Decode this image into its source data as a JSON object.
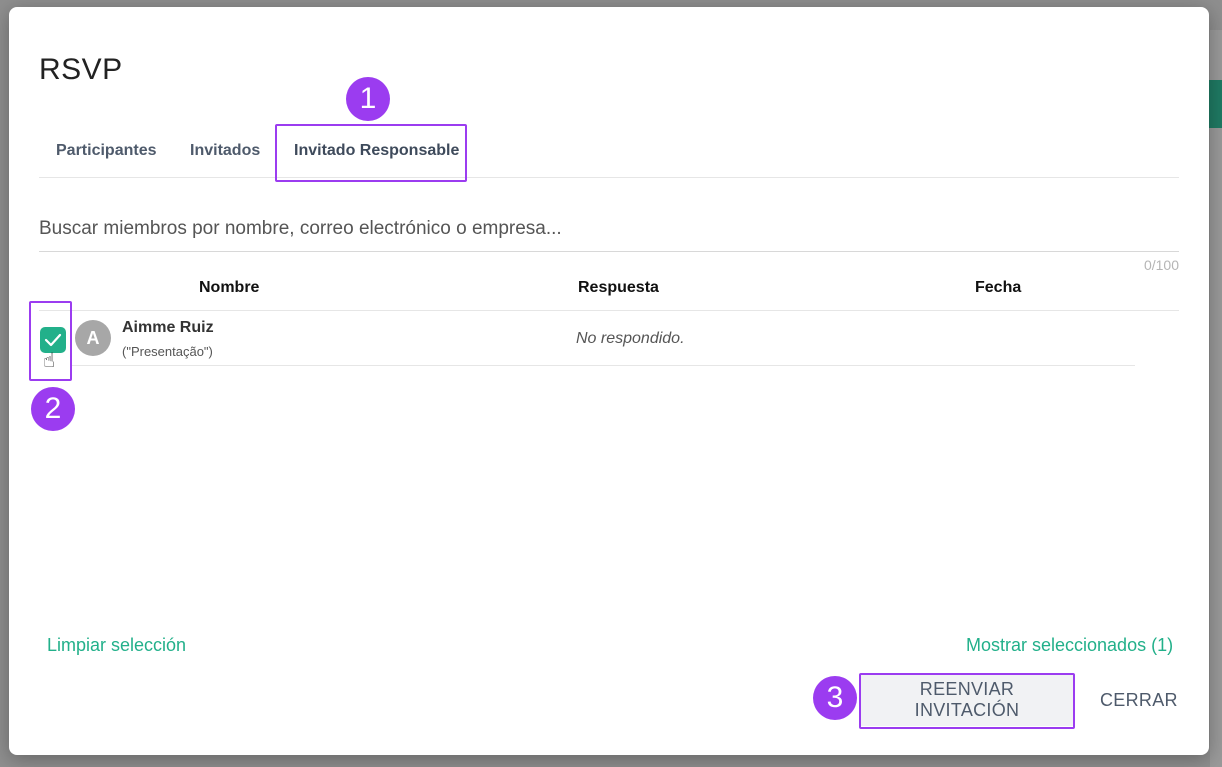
{
  "modal": {
    "title": "RSVP",
    "tabs": [
      {
        "label": "Participantes"
      },
      {
        "label": "Invitados"
      },
      {
        "label": "Invitado Responsable"
      }
    ],
    "active_tab": "Invitado Responsable",
    "search": {
      "placeholder": "Buscar miembros por nombre, correo electrónico o empresa...",
      "value": "",
      "counter": "0/100"
    },
    "table": {
      "headers": [
        "Nombre",
        "Respuesta",
        "Fecha"
      ],
      "rows": [
        {
          "avatar_initial": "A",
          "name": "Aimme Ruiz",
          "subtitle": "(\"Presentação\")",
          "response": "No respondido.",
          "date": "",
          "checked": true
        }
      ]
    },
    "footer": {
      "clear_selection": "Limpiar selección",
      "show_selected": "Mostrar seleccionados (1)",
      "resend_button": "REENVIAR INVITACIÓN",
      "close_button": "CERRAR"
    }
  },
  "annotations": {
    "badge_1": "1",
    "badge_2": "2",
    "badge_3": "3"
  },
  "colors": {
    "accent": "#22b08a",
    "highlight": "#9b3cf0",
    "text_muted": "#4e5a6b"
  },
  "icons": {
    "checkbox": "check-icon",
    "cursor": "hand-pointer-icon"
  }
}
